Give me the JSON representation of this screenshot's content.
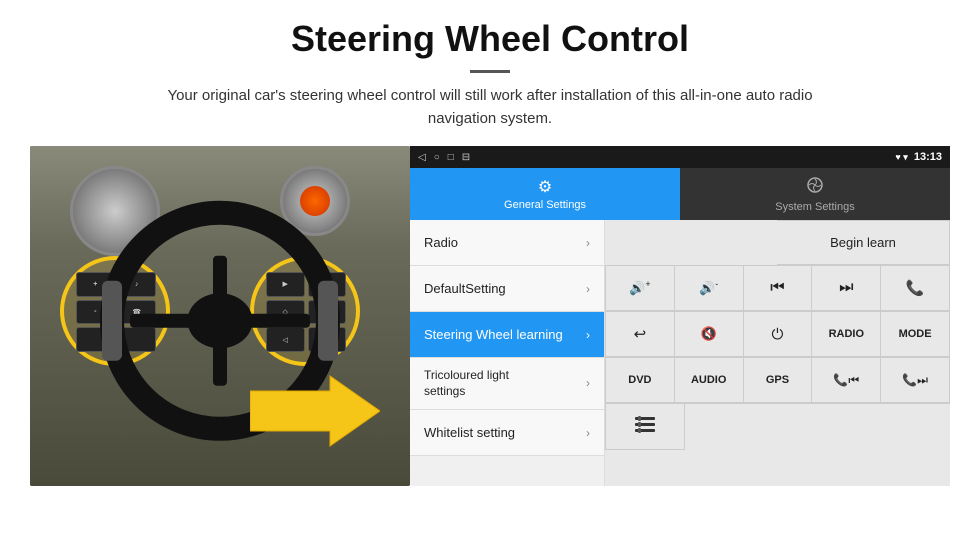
{
  "header": {
    "title": "Steering Wheel Control",
    "divider": true,
    "subtitle": "Your original car's steering wheel control will still work after installation of this all-in-one auto radio navigation system."
  },
  "status_bar": {
    "icons": [
      "◁",
      "○",
      "□",
      "⊟"
    ],
    "right_icons": "♥ ▾",
    "time": "13:13"
  },
  "tabs": [
    {
      "id": "general",
      "label": "General Settings",
      "icon": "⚙",
      "active": true
    },
    {
      "id": "system",
      "label": "System Settings",
      "icon": "⊕",
      "active": false
    }
  ],
  "menu_items": [
    {
      "id": "radio",
      "label": "Radio",
      "active": false
    },
    {
      "id": "default",
      "label": "DefaultSetting",
      "active": false
    },
    {
      "id": "steering",
      "label": "Steering Wheel learning",
      "active": true
    },
    {
      "id": "tricoloured",
      "label": "Tricoloured light settings",
      "active": false
    },
    {
      "id": "whitelist",
      "label": "Whitelist setting",
      "active": false
    }
  ],
  "right_panel": {
    "begin_learn_label": "Begin learn",
    "buttons_row1": [
      {
        "id": "vol_up",
        "icon": "🔊+",
        "label": ""
      },
      {
        "id": "vol_down",
        "icon": "🔊-",
        "label": ""
      },
      {
        "id": "prev_track",
        "icon": "⏮",
        "label": ""
      },
      {
        "id": "next_track",
        "icon": "⏭",
        "label": ""
      },
      {
        "id": "phone",
        "icon": "📞",
        "label": ""
      }
    ],
    "buttons_row2": [
      {
        "id": "answer",
        "icon": "↩",
        "label": ""
      },
      {
        "id": "mute",
        "icon": "🔇×",
        "label": ""
      },
      {
        "id": "power",
        "icon": "⏻",
        "label": ""
      },
      {
        "id": "radio_btn",
        "icon": "",
        "label": "RADIO"
      },
      {
        "id": "mode",
        "icon": "",
        "label": "MODE"
      }
    ],
    "buttons_row3": [
      {
        "id": "dvd",
        "icon": "",
        "label": "DVD"
      },
      {
        "id": "audio",
        "icon": "",
        "label": "AUDIO"
      },
      {
        "id": "gps",
        "icon": "",
        "label": "GPS"
      },
      {
        "id": "phone_prev",
        "icon": "📞⏮",
        "label": ""
      },
      {
        "id": "phone_next",
        "icon": "📞⏭",
        "label": ""
      }
    ],
    "buttons_row4": [
      {
        "id": "list_icon",
        "icon": "☰",
        "label": ""
      }
    ]
  }
}
